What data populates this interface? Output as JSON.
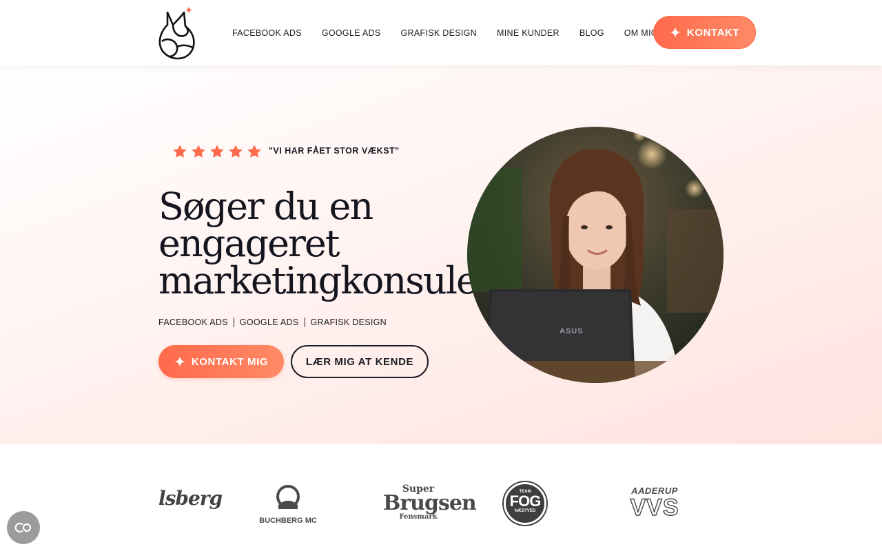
{
  "header": {
    "nav": [
      "FACEBOOK ADS",
      "GOOGLE ADS",
      "GRAFISK DESIGN",
      "MINE KUNDER",
      "BLOG",
      "OM MIG"
    ],
    "cta_label": "KONTAKT"
  },
  "hero": {
    "rating_stars": 5,
    "quote": "\"VI HAR FÅET STOR VÆKST\"",
    "headline_lines": [
      "Søger du en",
      "engageret",
      "marketingkonsulent?"
    ],
    "services": [
      "FACEBOOK ADS",
      "GOOGLE ADS",
      "GRAFISK DESIGN"
    ],
    "primary_cta": "KONTAKT MIG",
    "secondary_cta": "LÆR MIG AT KENDE"
  },
  "clients": {
    "logo1": "lsberg",
    "logo2": "BUCHBERG MC",
    "logo3_top": "Super",
    "logo3_main": "Brugsen",
    "logo3_sub": "Fensmark",
    "logo4_top": "TEAM",
    "logo4_main": "FOG",
    "logo4_sub": "NÆSTVED",
    "logo5_top": "AADERUP",
    "logo5_main": "VVS"
  },
  "portrait_laptop_brand": "ASUS",
  "colors": {
    "accent": "#ff6a4b",
    "text": "#1b1b24",
    "hero_bg": "#ffe3df"
  },
  "icons": {
    "logo": "fox-logo-icon",
    "sparkle": "sparkle-icon",
    "star": "star-icon",
    "cookie": "cookie-icon"
  }
}
